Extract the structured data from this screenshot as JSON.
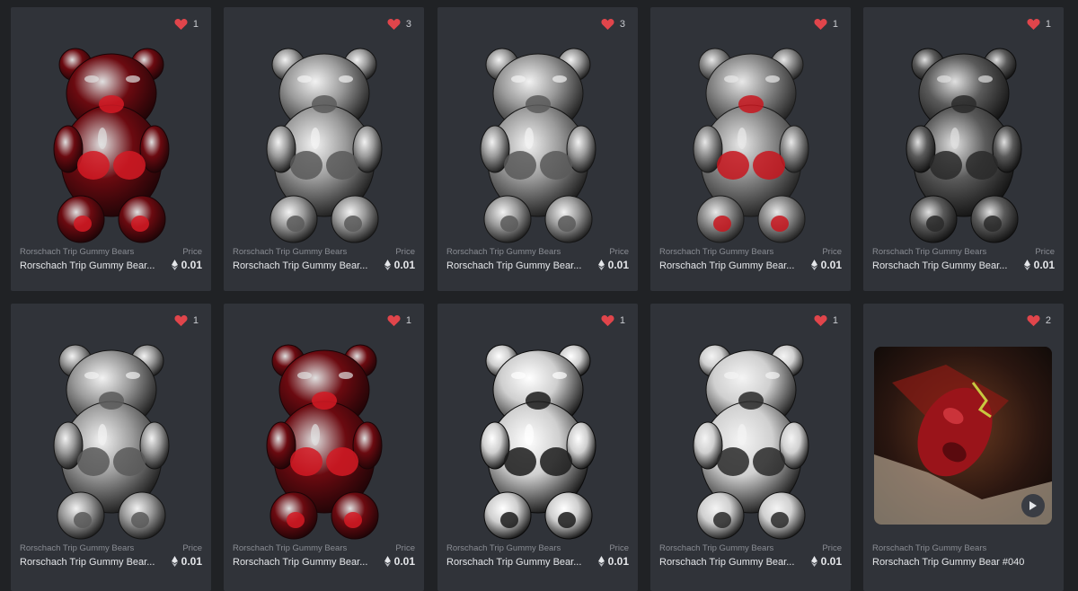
{
  "colors": {
    "page_bg": "#202225",
    "card_bg": "#303339",
    "heart": "#e0454b",
    "muted_text": "#8a8d94",
    "primary_text": "#e5e7ea"
  },
  "cards": [
    {
      "collection": "Rorschach Trip Gummy Bears",
      "name": "Rorschach Trip Gummy Bear...",
      "price_label": "Price",
      "price": "0.01",
      "favorites": "1",
      "style": "red",
      "media": "image"
    },
    {
      "collection": "Rorschach Trip Gummy Bears",
      "name": "Rorschach Trip Gummy Bear...",
      "price_label": "Price",
      "price": "0.01",
      "favorites": "3",
      "style": "silver",
      "media": "image"
    },
    {
      "collection": "Rorschach Trip Gummy Bears",
      "name": "Rorschach Trip Gummy Bear...",
      "price_label": "Price",
      "price": "0.01",
      "favorites": "3",
      "style": "silver",
      "media": "image"
    },
    {
      "collection": "Rorschach Trip Gummy Bears",
      "name": "Rorschach Trip Gummy Bear...",
      "price_label": "Price",
      "price": "0.01",
      "favorites": "1",
      "style": "redmix",
      "media": "image"
    },
    {
      "collection": "Rorschach Trip Gummy Bears",
      "name": "Rorschach Trip Gummy Bear...",
      "price_label": "Price",
      "price": "0.01",
      "favorites": "1",
      "style": "dark",
      "media": "image"
    },
    {
      "collection": "Rorschach Trip Gummy Bears",
      "name": "Rorschach Trip Gummy Bear...",
      "price_label": "Price",
      "price": "0.01",
      "favorites": "1",
      "style": "silver",
      "media": "image"
    },
    {
      "collection": "Rorschach Trip Gummy Bears",
      "name": "Rorschach Trip Gummy Bear...",
      "price_label": "Price",
      "price": "0.01",
      "favorites": "1",
      "style": "red",
      "media": "image"
    },
    {
      "collection": "Rorschach Trip Gummy Bears",
      "name": "Rorschach Trip Gummy Bear...",
      "price_label": "Price",
      "price": "0.01",
      "favorites": "1",
      "style": "stripe",
      "media": "image"
    },
    {
      "collection": "Rorschach Trip Gummy Bears",
      "name": "Rorschach Trip Gummy Bear...",
      "price_label": "Price",
      "price": "0.01",
      "favorites": "1",
      "style": "speckle",
      "media": "image"
    },
    {
      "collection": "Rorschach Trip Gummy Bears",
      "name": "Rorschach Trip Gummy Bear #040",
      "price_label": "",
      "price": "",
      "favorites": "2",
      "style": "video",
      "media": "video"
    }
  ]
}
